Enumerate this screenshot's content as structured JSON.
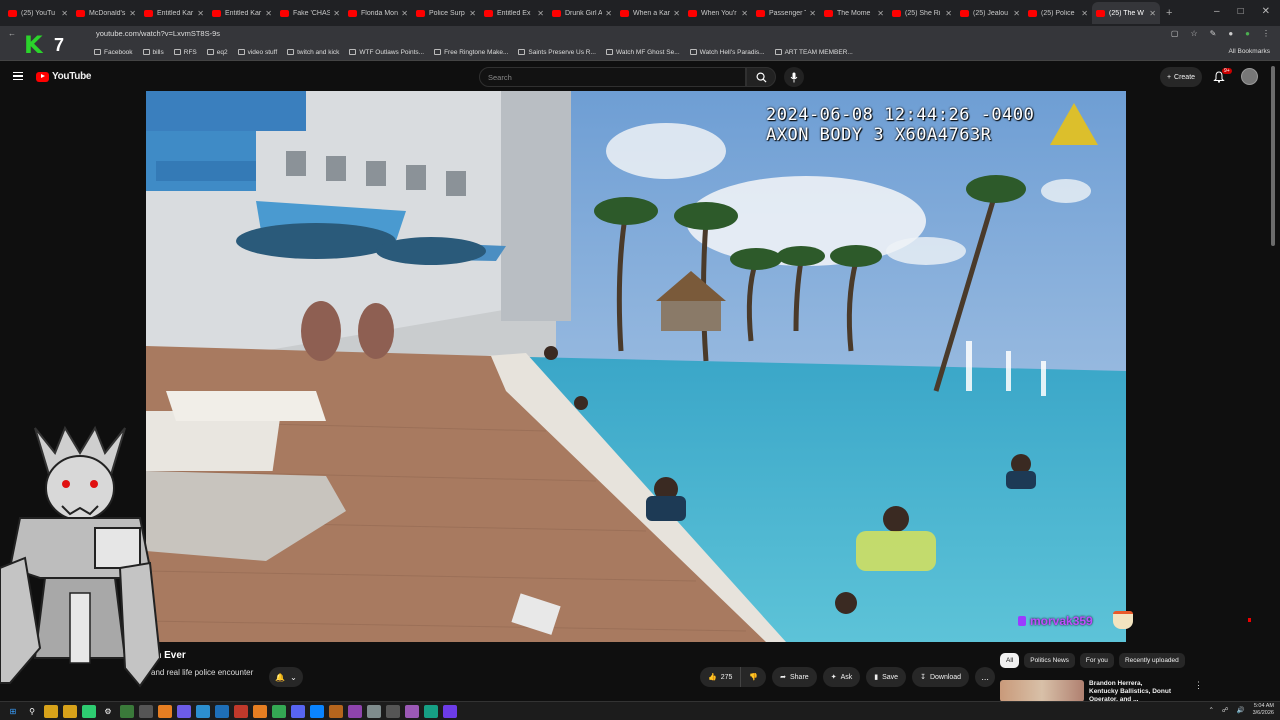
{
  "browser": {
    "tabs": [
      {
        "label": "(25) YouTu"
      },
      {
        "label": "McDonald's"
      },
      {
        "label": "Entitled Kar"
      },
      {
        "label": "Entitled Kar"
      },
      {
        "label": "Fake 'CHAS"
      },
      {
        "label": "Florida Mon"
      },
      {
        "label": "Police Surp"
      },
      {
        "label": "Entitled Ex"
      },
      {
        "label": "Drunk Girl A"
      },
      {
        "label": "When a Kar"
      },
      {
        "label": "When You'r"
      },
      {
        "label": "Passenger T"
      },
      {
        "label": "The Mome"
      },
      {
        "label": "(25) She Ri"
      },
      {
        "label": "(25) Jealou"
      },
      {
        "label": "(25) Police"
      },
      {
        "label": "(25) The W"
      }
    ],
    "new_tab_label": "+",
    "url": "youtube.com/watch?v=LxvmST8S-9s",
    "bookmarks": [
      {
        "label": "Facebook"
      },
      {
        "label": "bills"
      },
      {
        "label": "RFS"
      },
      {
        "label": "eq2"
      },
      {
        "label": "video stuff"
      },
      {
        "label": "twitch and kick"
      },
      {
        "label": "WTF Outlaws Points..."
      },
      {
        "label": "Free Ringtone Make..."
      },
      {
        "label": "Saints Preserve Us R..."
      },
      {
        "label": "Watch MF Ghost Se..."
      },
      {
        "label": "Watch Hell's Paradis..."
      },
      {
        "label": "ART TEAM MEMBER..."
      }
    ],
    "all_bookmarks_label": "All Bookmarks"
  },
  "youtube": {
    "logo_text": "YouTube",
    "search_placeholder": "Search",
    "create_label": "Create",
    "notification_count": "9+"
  },
  "video": {
    "timestamp_line1": "2024-06-08 12:44:26 -0400",
    "timestamp_line2": "AXON BODY 3 X60A4763R",
    "streamer_name": "morvak359"
  },
  "overlay": {
    "k7_letter": "K",
    "k7_number": "7"
  },
  "below_video": {
    "title_partial": "tion Ever",
    "desc_partial": "w and real life police encounter",
    "like_count": "275",
    "share_label": "Share",
    "ask_label": "Ask",
    "save_label": "Save",
    "download_label": "Download",
    "more_label": "..."
  },
  "sidebar": {
    "chips": [
      {
        "label": "All"
      },
      {
        "label": "Politics News"
      },
      {
        "label": "For you"
      },
      {
        "label": "Recently uploaded"
      }
    ],
    "reco_title": "Brandon Herrera, Kentucky Ballistics, Donut Operator, and ..."
  },
  "taskbar": {
    "time": "5:04 AM",
    "date": "3/6/2026"
  }
}
